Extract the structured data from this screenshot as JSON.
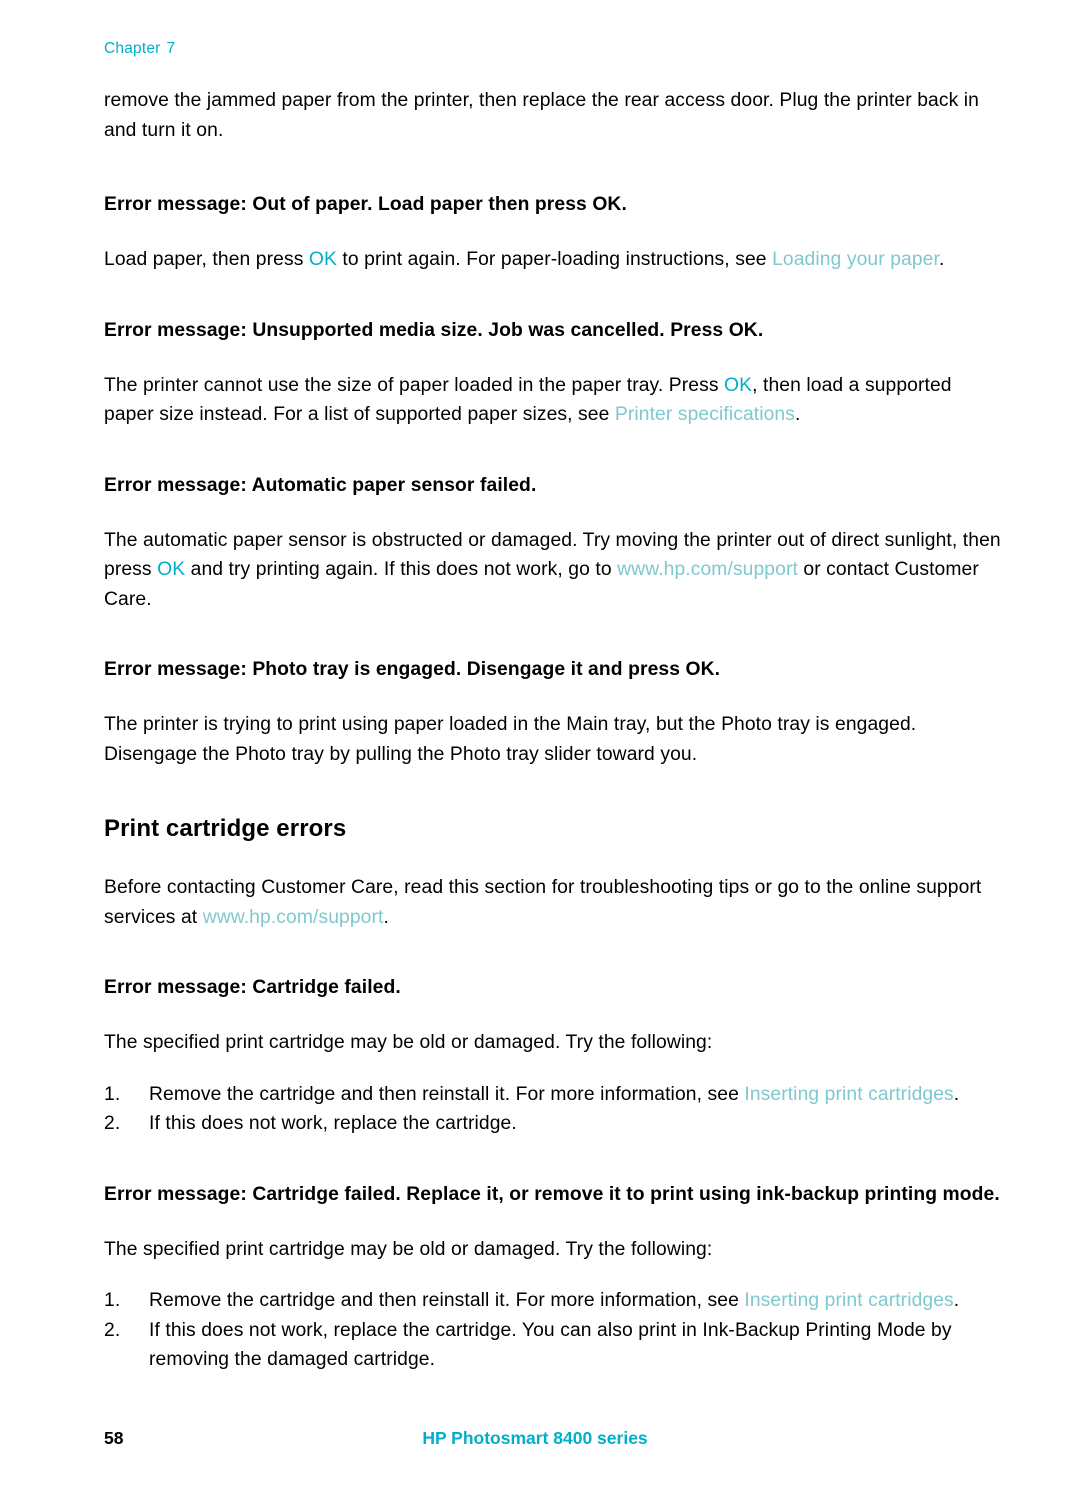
{
  "header": {
    "chapter_word": "Chapter",
    "chapter_number": "7"
  },
  "colors": {
    "accent": "#00b0c8",
    "link": "#7fc8cf",
    "text": "#000000"
  },
  "body": {
    "intro_paragraph": "remove the jammed paper from the printer, then replace the rear access door. Plug the printer back in and turn it on.",
    "err1_head": "Error message: Out of paper. Load paper then press OK.",
    "err1_p_a": "Load paper, then press ",
    "err1_ok": "OK",
    "err1_p_b": " to print again. For paper-loading instructions, see ",
    "err1_link": "Loading your paper",
    "err1_p_c": ".",
    "err2_head": "Error message: Unsupported media size. Job was cancelled. Press OK.",
    "err2_p_a": "The printer cannot use the size of paper loaded in the paper tray. Press ",
    "err2_ok": "OK",
    "err2_p_b": ", then load a supported paper size instead. For a list of supported paper sizes, see ",
    "err2_link": "Printer specifications",
    "err2_p_c": ".",
    "err3_head": "Error message: Automatic paper sensor failed.",
    "err3_p_a": "The automatic paper sensor is obstructed or damaged. Try moving the printer out of direct sunlight, then press ",
    "err3_ok": "OK",
    "err3_p_b": " and try printing again. If this does not work, go to ",
    "err3_link": "www.hp.com/support",
    "err3_p_c": " or contact Customer Care.",
    "err4_head": "Error message: Photo tray is engaged. Disengage it and press OK.",
    "err4_p": "The printer is trying to print using paper loaded in the Main tray, but the Photo tray is engaged. Disengage the Photo tray by pulling the Photo tray slider toward you.",
    "section_title": "Print cartridge errors",
    "section_p_a": "Before contacting Customer Care, read this section for troubleshooting tips or go to the online support services at ",
    "section_link": "www.hp.com/support",
    "section_p_b": ".",
    "err5_head": "Error message: Cartridge failed.",
    "err5_p": "The specified print cartridge may be old or damaged. Try the following:",
    "err5_item1_num": "1.",
    "err5_item1_a": "Remove the cartridge and then reinstall it. For more information, see ",
    "err5_item1_link": "Inserting print cartridges",
    "err5_item1_b": ".",
    "err5_item2_num": "2.",
    "err5_item2": "If this does not work, replace the cartridge.",
    "err6_head": "Error message: Cartridge failed. Replace it, or remove it to print using ink-backup printing mode.",
    "err6_p": "The specified print cartridge may be old or damaged. Try the following:",
    "err6_item1_num": "1.",
    "err6_item1_a": "Remove the cartridge and then reinstall it. For more information, see ",
    "err6_item1_link": "Inserting print cartridges",
    "err6_item1_b": ".",
    "err6_item2_num": "2.",
    "err6_item2": "If this does not work, replace the cartridge. You can also print in Ink-Backup Printing Mode by removing the damaged cartridge."
  },
  "footer": {
    "page_number": "58",
    "product_title": "HP Photosmart 8400 series"
  }
}
